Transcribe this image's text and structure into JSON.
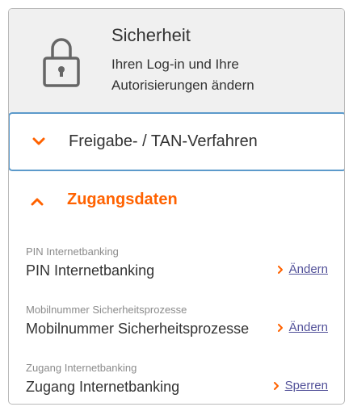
{
  "header": {
    "title": "Sicherheit",
    "description": "Ihren Log-in und Ihre Autorisierungen ändern",
    "icon": "lock-icon"
  },
  "accordion": {
    "collapsed_label": "Freigabe- / TAN-Verfahren",
    "expanded_label": "Zugangsdaten"
  },
  "rows": [
    {
      "caption": "PIN Internetbanking",
      "title": "PIN Internetbanking",
      "action": "Ändern"
    },
    {
      "caption": "Mobilnummer Sicherheitsprozesse",
      "title": "Mobilnummer Sicherheitsprozesse",
      "action": "Ändern"
    },
    {
      "caption": "Zugang Internetbanking",
      "title": "Zugang Internetbanking",
      "action": "Sperren"
    }
  ],
  "colors": {
    "accent": "#ff6200",
    "focus_border": "#5c9acb",
    "link": "#525199",
    "header_bg": "#f0f0f0"
  }
}
